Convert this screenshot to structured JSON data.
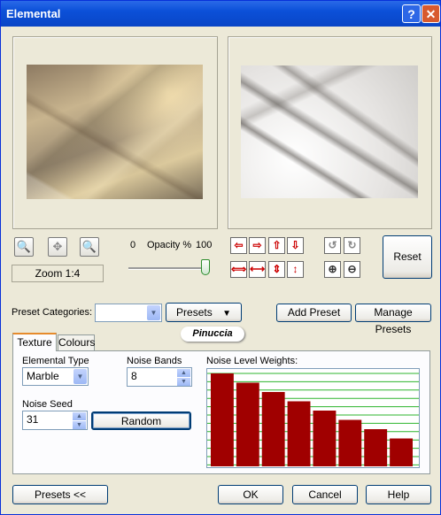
{
  "window": {
    "title": "Elemental",
    "help_glyph": "?",
    "close_glyph": "✕"
  },
  "zoom": {
    "label": "Zoom 1:4"
  },
  "opacity": {
    "min_label": "0",
    "label": "Opacity %",
    "max_label": "100",
    "value": 100
  },
  "buttons": {
    "reset": "Reset",
    "add_preset": "Add Preset",
    "manage_presets": "Manage Presets",
    "presets_menu": "Presets",
    "presets_toggle": "Presets <<",
    "random": "Random",
    "ok": "OK",
    "cancel": "Cancel",
    "help": "Help"
  },
  "preset_categories": {
    "label": "Preset Categories:",
    "value": ""
  },
  "watermark": "Pinuccia",
  "tabs": [
    {
      "label": "Texture"
    },
    {
      "label": "Colours"
    }
  ],
  "texture": {
    "elemental_type_label": "Elemental Type",
    "elemental_type_value": "Marble",
    "noise_bands_label": "Noise Bands",
    "noise_bands_value": "8",
    "noise_seed_label": "Noise Seed",
    "noise_seed_value": "31",
    "noise_weights_label": "Noise Level Weights:"
  },
  "chart_data": {
    "type": "bar",
    "values": [
      1.0,
      0.9,
      0.8,
      0.7,
      0.6,
      0.5,
      0.4,
      0.3
    ],
    "color": "#a00000"
  }
}
